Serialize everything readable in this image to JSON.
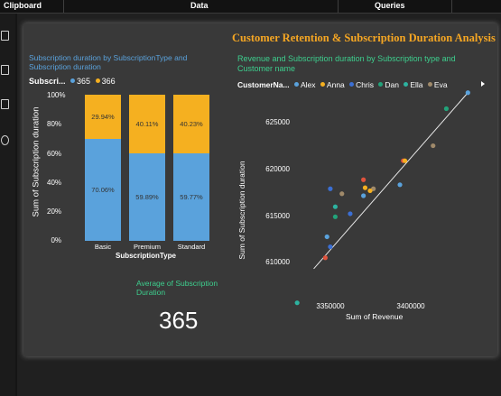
{
  "ribbon": {
    "clipboard": "Clipboard",
    "data": "Data",
    "queries": "Queries"
  },
  "report": {
    "title": "Customer Retention & Subscription Duration Analysis"
  },
  "visuals": {
    "stacked_bar": {
      "title": "Subscription duration by SubscriptionType and Subscription duration",
      "legend_label": "Subscri...",
      "legend_items": [
        {
          "label": "365",
          "color": "#5aa2dc"
        },
        {
          "label": "366",
          "color": "#f5b020"
        }
      ],
      "y_title": "Sum of Subscription duration",
      "x_title": "SubscriptionType",
      "y_ticks": [
        "100%",
        "80%",
        "60%",
        "40%",
        "20%",
        "0%"
      ]
    },
    "card": {
      "title": "Average of Subscription Duration",
      "value": "365"
    },
    "scatter": {
      "title": "Revenue and Subscription duration by Subscription type and Customer name",
      "legend_label": "CustomerNa...",
      "legend_items": [
        {
          "label": "Alex",
          "color": "#5aa2dc"
        },
        {
          "label": "Anna",
          "color": "#f5b020"
        },
        {
          "label": "Chris",
          "color": "#3b6fd4"
        },
        {
          "label": "Dan",
          "color": "#22a37a"
        },
        {
          "label": "Ella",
          "color": "#2db3a0"
        },
        {
          "label": "Eva",
          "color": "#a08a6a"
        }
      ],
      "y_title": "Sum of Subscription duration",
      "x_title": "Sum of Revenue",
      "y_ticks": [
        "625000",
        "620000",
        "615000",
        "610000"
      ],
      "x_ticks": [
        "3350000",
        "3400000"
      ]
    }
  },
  "chart_data": [
    {
      "type": "bar",
      "stacked": true,
      "percent": true,
      "title": "Subscription duration by SubscriptionType and Subscription duration",
      "xlabel": "SubscriptionType",
      "ylabel": "Sum of Subscription duration",
      "categories": [
        "Basic",
        "Premium",
        "Standard"
      ],
      "series": [
        {
          "name": "365",
          "color": "#5aa2dc",
          "values": [
            70.06,
            59.89,
            59.77
          ],
          "labels": [
            "70.06%",
            "59.89%",
            "59.77%"
          ]
        },
        {
          "name": "366",
          "color": "#f5b020",
          "values": [
            29.94,
            40.11,
            40.23
          ],
          "labels": [
            "29.94%",
            "40.11%",
            "40.23%"
          ]
        }
      ],
      "ylim": [
        0,
        100
      ],
      "legend": "top-left"
    },
    {
      "type": "scatter",
      "title": "Revenue and Subscription duration by Subscription type and Customer name",
      "xlabel": "Sum of Revenue",
      "ylabel": "Sum of Subscription duration",
      "xlim": [
        3320000,
        3430000
      ],
      "ylim": [
        606000,
        628000
      ],
      "trendline": {
        "x": [
          3335000,
          3428000
        ],
        "y": [
          609700,
          627300
        ]
      },
      "points": [
        {
          "x": 3325000,
          "y": 606300,
          "color": "#2db3a0"
        },
        {
          "x": 3342000,
          "y": 610800,
          "color": "#e0533d"
        },
        {
          "x": 3345000,
          "y": 611900,
          "color": "#3b6fd4"
        },
        {
          "x": 3343000,
          "y": 612900,
          "color": "#5aa2dc"
        },
        {
          "x": 3348000,
          "y": 614900,
          "color": "#22a37a"
        },
        {
          "x": 3348000,
          "y": 615900,
          "color": "#2db3a0"
        },
        {
          "x": 3345000,
          "y": 617700,
          "color": "#3b6fd4"
        },
        {
          "x": 3352000,
          "y": 617200,
          "color": "#a08a6a"
        },
        {
          "x": 3357000,
          "y": 615200,
          "color": "#3b6fd4"
        },
        {
          "x": 3365000,
          "y": 618600,
          "color": "#e0533d"
        },
        {
          "x": 3366000,
          "y": 617800,
          "color": "#f5b020"
        },
        {
          "x": 3365000,
          "y": 617000,
          "color": "#5aa2dc"
        },
        {
          "x": 3371000,
          "y": 617700,
          "color": "#a08a6a"
        },
        {
          "x": 3369000,
          "y": 617500,
          "color": "#f5b020"
        },
        {
          "x": 3387000,
          "y": 618100,
          "color": "#5aa2dc"
        },
        {
          "x": 3389000,
          "y": 620500,
          "color": "#e0533d"
        },
        {
          "x": 3390000,
          "y": 620500,
          "color": "#f5b020"
        },
        {
          "x": 3407000,
          "y": 622000,
          "color": "#a08a6a"
        },
        {
          "x": 3415000,
          "y": 625700,
          "color": "#22a37a"
        },
        {
          "x": 3428000,
          "y": 627300,
          "color": "#5aa2dc"
        }
      ]
    }
  ]
}
